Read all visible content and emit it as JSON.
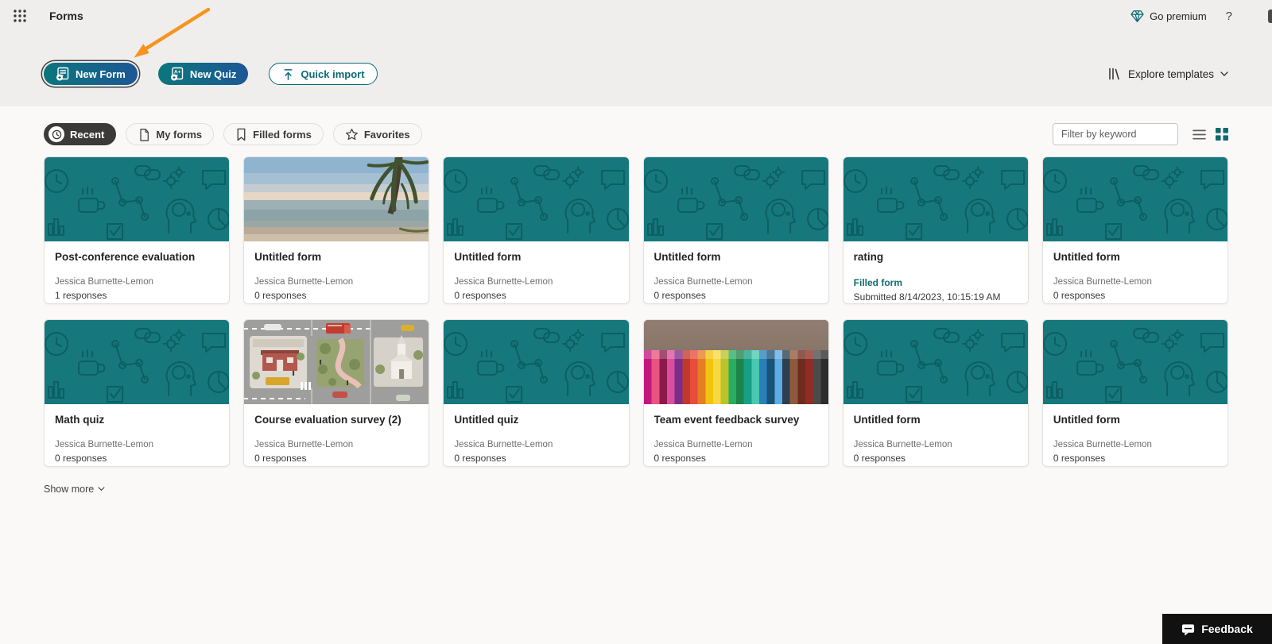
{
  "header": {
    "app_title": "Forms",
    "go_premium_label": "Go premium",
    "help_label": "?"
  },
  "toolbar": {
    "new_form_label": "New Form",
    "new_quiz_label": "New Quiz",
    "quick_import_label": "Quick import",
    "explore_templates_label": "Explore templates"
  },
  "filters": {
    "tabs": [
      {
        "label": "Recent",
        "icon": "clock-icon",
        "selected": true
      },
      {
        "label": "My forms",
        "icon": "document-icon",
        "selected": false
      },
      {
        "label": "Filled forms",
        "icon": "bookmark-icon",
        "selected": false
      },
      {
        "label": "Favorites",
        "icon": "star-icon",
        "selected": false
      }
    ],
    "search_placeholder": "Filter by keyword",
    "view_icons": [
      "list-view-icon",
      "grid-view-icon"
    ],
    "active_view": "grid"
  },
  "cards": [
    {
      "title": "Post-conference evaluation",
      "meta_primary": "Jessica Burnette-Lemon",
      "meta_secondary": "1 responses",
      "is_filled": false,
      "thumb": "doodle"
    },
    {
      "title": "Untitled form",
      "meta_primary": "Jessica Burnette-Lemon",
      "meta_secondary": "0 responses",
      "is_filled": false,
      "thumb": "beach"
    },
    {
      "title": "Untitled form",
      "meta_primary": "Jessica Burnette-Lemon",
      "meta_secondary": "0 responses",
      "is_filled": false,
      "thumb": "doodle"
    },
    {
      "title": "Untitled form",
      "meta_primary": "Jessica Burnette-Lemon",
      "meta_secondary": "0 responses",
      "is_filled": false,
      "thumb": "doodle"
    },
    {
      "title": "rating",
      "meta_primary": "Filled form",
      "meta_secondary": "Submitted 8/14/2023, 10:15:19 AM",
      "is_filled": true,
      "thumb": "doodle"
    },
    {
      "title": "Untitled form",
      "meta_primary": "Jessica Burnette-Lemon",
      "meta_secondary": "0 responses",
      "is_filled": false,
      "thumb": "doodle"
    },
    {
      "title": "Math quiz",
      "meta_primary": "Jessica Burnette-Lemon",
      "meta_secondary": "0 responses",
      "is_filled": false,
      "thumb": "doodle"
    },
    {
      "title": "Course evaluation survey (2)",
      "meta_primary": "Jessica Burnette-Lemon",
      "meta_secondary": "0 responses",
      "is_filled": false,
      "thumb": "town"
    },
    {
      "title": "Untitled quiz",
      "meta_primary": "Jessica Burnette-Lemon",
      "meta_secondary": "0 responses",
      "is_filled": false,
      "thumb": "doodle"
    },
    {
      "title": "Team event feedback survey",
      "meta_primary": "Jessica Burnette-Lemon",
      "meta_secondary": "0 responses",
      "is_filled": false,
      "thumb": "pencils"
    },
    {
      "title": "Untitled form",
      "meta_primary": "Jessica Burnette-Lemon",
      "meta_secondary": "0 responses",
      "is_filled": false,
      "thumb": "doodle"
    },
    {
      "title": "Untitled form",
      "meta_primary": "Jessica Burnette-Lemon",
      "meta_secondary": "0 responses",
      "is_filled": false,
      "thumb": "doodle"
    }
  ],
  "footer": {
    "show_more_label": "Show more",
    "feedback_label": "Feedback"
  },
  "annotation": {
    "type": "arrow",
    "points_at": "New Form button",
    "color": "#F7941D"
  },
  "icons": {
    "app_launcher": "waffle-icon",
    "premium": "diamond-icon",
    "help": "question-mark-icon",
    "new_form": "form-plus-icon",
    "new_quiz": "quiz-plus-icon",
    "quick_import": "upload-arrow-icon",
    "explore_templates": "library-icon",
    "show_more": "chevron-down-icon",
    "feedback": "speech-bubble-icon"
  },
  "colors": {
    "accent_teal": "#0B6A75",
    "button_gradient_start": "#0B767C",
    "button_gradient_end": "#1E5796",
    "selected_pill": "#3B3A39",
    "thumbnail_teal": "#16787C",
    "top_region_bg": "#EFEEED",
    "content_bg": "#FAF9F8",
    "feedback_bg": "#111111",
    "annotation_arrow": "#F7941D"
  }
}
